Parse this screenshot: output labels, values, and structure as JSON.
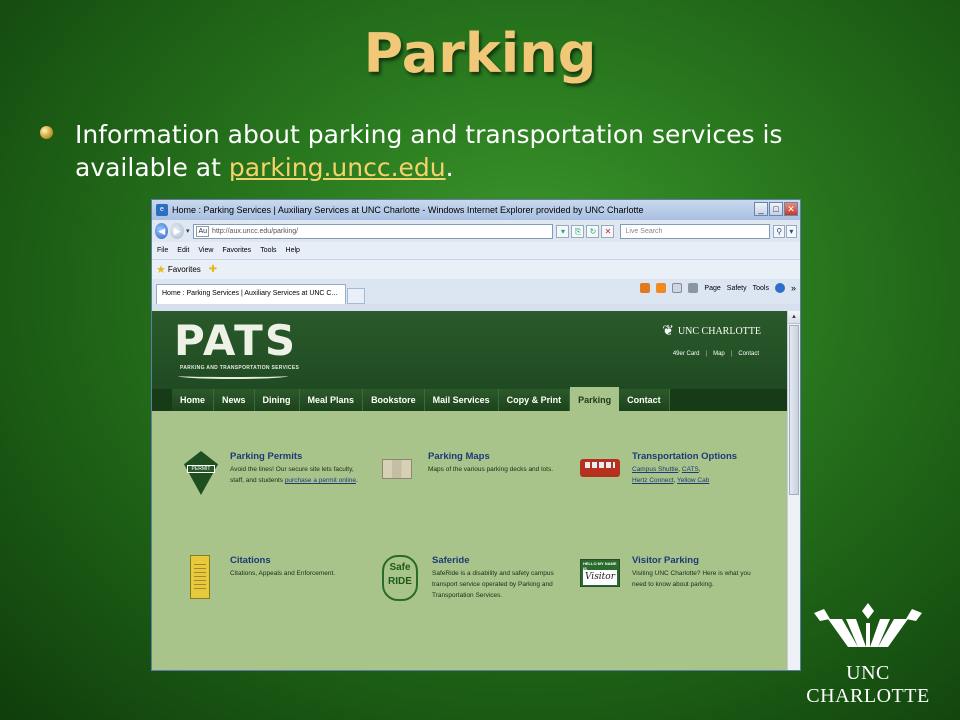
{
  "slide": {
    "title": "Parking",
    "bullet_text": "Information about parking and transportation services is available at ",
    "bullet_link": "parking.uncc.edu",
    "bullet_end": "."
  },
  "browser": {
    "window_title": "Home : Parking Services | Auxiliary Services at UNC Charlotte - Windows Internet Explorer provided by UNC Charlotte",
    "favicon_text": "Au",
    "url": "http://aux.uncc.edu/parking/",
    "search_placeholder": "Live Search",
    "menu": [
      "File",
      "Edit",
      "View",
      "Favorites",
      "Tools",
      "Help"
    ],
    "favorites_label": "Favorites",
    "tab_label": "Home : Parking Services | Auxiliary Services at UNC C...",
    "command_bar": [
      "Page",
      "Safety",
      "Tools"
    ],
    "chevron": "»"
  },
  "site": {
    "logo_text": "PATS",
    "logo_sub": "PARKING AND TRANSPORTATION SERVICES",
    "brand": "UNC CHARLOTTE",
    "header_links": [
      "49er Card",
      "Map",
      "Contact"
    ],
    "nav": [
      "Home",
      "News",
      "Dining",
      "Meal Plans",
      "Bookstore",
      "Mail Services",
      "Copy & Print",
      "Parking",
      "Contact"
    ],
    "active_nav": "Parking",
    "services": {
      "permits": {
        "title": "Parking Permits",
        "desc": "Avoid the lines! Our secure site lets faculty, staff, and students",
        "link": "purchase a permit online",
        "end": ".",
        "icon_label": "PERMIT"
      },
      "maps": {
        "title": "Parking Maps",
        "desc": "Maps of the various parking decks and lots."
      },
      "transport": {
        "title": "Transportation Options",
        "links": [
          "Campus Shuttle",
          "CATS",
          "Hertz Connect",
          "Yellow Cab"
        ]
      },
      "citations": {
        "title": "Citations",
        "desc": "Citations, Appeals and Enforcement."
      },
      "saferide": {
        "title": "Saferide",
        "desc": "SafeRide is a disability and safety campus transport service operated by Parking and Transportation Services.",
        "icon_text": "Safe RIDE"
      },
      "visitor": {
        "title": "Visitor Parking",
        "desc": "Visiting UNC Charlotte? Here is what you need to know about parking.",
        "icon_top": "HELLO MY NAME IS",
        "icon_text": "Visitor"
      }
    }
  },
  "footer": {
    "brand": "UNC CHARLOTTE"
  },
  "colors": {
    "background": "#2a7a1f",
    "title": "#f0c878",
    "link": "#f5d26a",
    "site_green": "#1d4620",
    "page_bg": "#a8c48a",
    "service_title": "#1d3a78"
  }
}
